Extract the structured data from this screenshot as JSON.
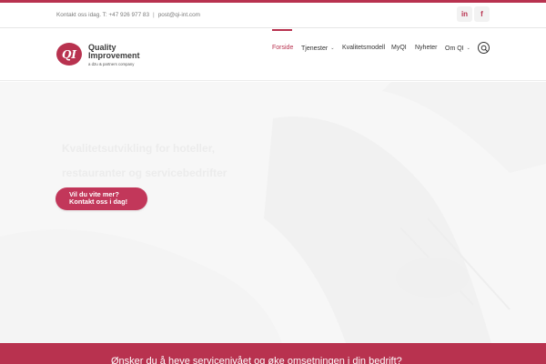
{
  "colors": {
    "accent": "#b8324f",
    "cta": "#c2375a",
    "hero_bg": "#f7f7f7"
  },
  "topbar": {
    "contact_text": "Kontakt oss idag. T: +47 926 977 83",
    "separator": "|",
    "email": "post@qi-int.com",
    "social": [
      {
        "icon": "linkedin-icon",
        "glyph": "in"
      },
      {
        "icon": "facebook-icon",
        "glyph": "f"
      }
    ]
  },
  "logo": {
    "mark": "QI",
    "line1": "Quality",
    "line2": "Improvement",
    "tagline": "a d2u & partners company"
  },
  "nav": {
    "items": [
      {
        "label": "Forside",
        "active": true,
        "dropdown": false
      },
      {
        "label": "Tjenester",
        "active": false,
        "dropdown": true
      },
      {
        "label": "Kvalitetsmodell",
        "active": false,
        "dropdown": false
      },
      {
        "label": "MyQI",
        "active": false,
        "dropdown": false
      },
      {
        "label": "Nyheter",
        "active": false,
        "dropdown": false
      },
      {
        "label": "Om QI",
        "active": false,
        "dropdown": true
      }
    ],
    "dropdown_glyph": "⌄",
    "search_icon": "search-icon"
  },
  "hero": {
    "title_line1": "Kvalitetsutvikling for hoteller,",
    "title_line2": "restauranter og servicebedrifter",
    "cta_line1": "Vil du vite mer?",
    "cta_line2": "Kontakt oss i dag!"
  },
  "banner": {
    "text": "Ønsker du å heve servicenivået og øke omsetningen i din bedrift?"
  }
}
